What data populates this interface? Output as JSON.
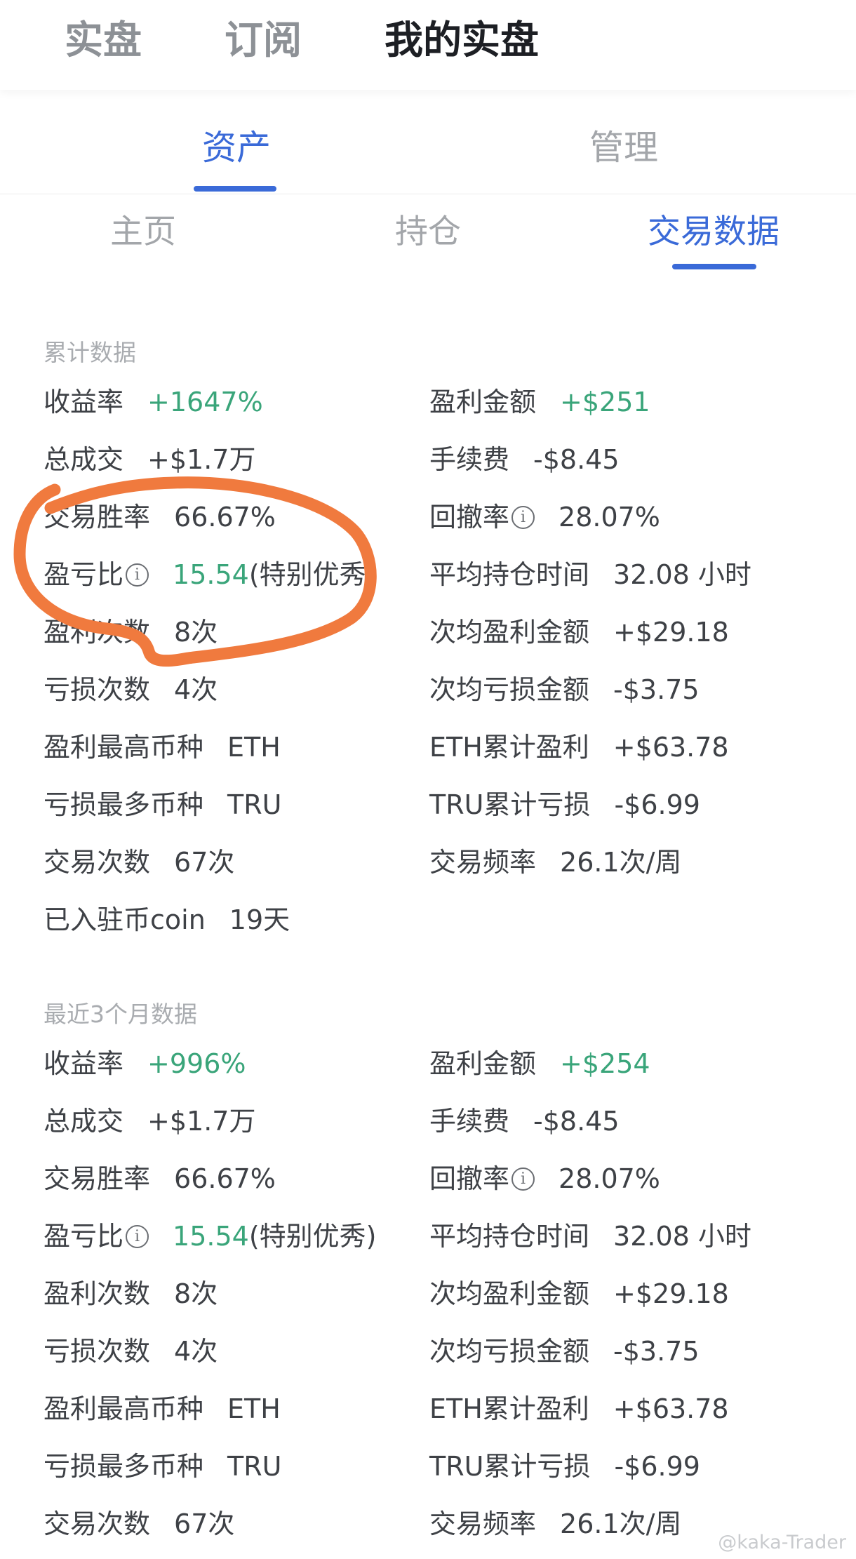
{
  "top_tabs": [
    "实盘",
    "订阅",
    "我的实盘"
  ],
  "top_tab_active": 2,
  "asset_tabs": [
    "资产",
    "管理"
  ],
  "asset_tab_active": 0,
  "sub_tabs": [
    "主页",
    "持仓",
    "交易数据"
  ],
  "sub_tab_active": 2,
  "sections": [
    {
      "title": "累计数据",
      "rows": [
        {
          "left": {
            "label": "收益率",
            "value": "+1647%",
            "green": true
          },
          "right": {
            "label": "盈利金额",
            "value": "+$251",
            "green": true
          }
        },
        {
          "left": {
            "label": "总成交",
            "value": "+$1.7万"
          },
          "right": {
            "label": "手续费",
            "value": "-$8.45"
          }
        },
        {
          "left": {
            "label": "交易胜率",
            "value": "66.67%"
          },
          "right": {
            "label": "回撤率",
            "info": true,
            "value": "28.07%"
          }
        },
        {
          "left": {
            "label": "盈亏比",
            "info": true,
            "value": "15.54",
            "green": true,
            "suffix": "(特别优秀)"
          },
          "right": {
            "label": "平均持仓时间",
            "value": "32.08 小时"
          }
        },
        {
          "left": {
            "label": "盈利次数",
            "value": "8次"
          },
          "right": {
            "label": "次均盈利金额",
            "value": "+$29.18"
          }
        },
        {
          "left": {
            "label": "亏损次数",
            "value": "4次"
          },
          "right": {
            "label": "次均亏损金额",
            "value": "-$3.75"
          }
        },
        {
          "left": {
            "label": "盈利最高币种",
            "value": "ETH"
          },
          "right": {
            "label": "ETH累计盈利",
            "value": "+$63.78"
          }
        },
        {
          "left": {
            "label": "亏损最多币种",
            "value": "TRU"
          },
          "right": {
            "label": "TRU累计亏损",
            "value": "-$6.99"
          }
        },
        {
          "left": {
            "label": "交易次数",
            "value": "67次"
          },
          "right": {
            "label": "交易频率",
            "value": "26.1次/周"
          }
        },
        {
          "left": {
            "label": "已入驻币coin",
            "value": "19天"
          }
        }
      ]
    },
    {
      "title": "最近3个月数据",
      "rows": [
        {
          "left": {
            "label": "收益率",
            "value": "+996%",
            "green": true
          },
          "right": {
            "label": "盈利金额",
            "value": "+$254",
            "green": true
          }
        },
        {
          "left": {
            "label": "总成交",
            "value": "+$1.7万"
          },
          "right": {
            "label": "手续费",
            "value": "-$8.45"
          }
        },
        {
          "left": {
            "label": "交易胜率",
            "value": "66.67%"
          },
          "right": {
            "label": "回撤率",
            "info": true,
            "value": "28.07%"
          }
        },
        {
          "left": {
            "label": "盈亏比",
            "info": true,
            "value": "15.54",
            "green": true,
            "suffix": "(特别优秀)"
          },
          "right": {
            "label": "平均持仓时间",
            "value": "32.08 小时"
          }
        },
        {
          "left": {
            "label": "盈利次数",
            "value": "8次"
          },
          "right": {
            "label": "次均盈利金额",
            "value": "+$29.18"
          }
        },
        {
          "left": {
            "label": "亏损次数",
            "value": "4次"
          },
          "right": {
            "label": "次均亏损金额",
            "value": "-$3.75"
          }
        },
        {
          "left": {
            "label": "盈利最高币种",
            "value": "ETH"
          },
          "right": {
            "label": "ETH累计盈利",
            "value": "+$63.78"
          }
        },
        {
          "left": {
            "label": "亏损最多币种",
            "value": "TRU"
          },
          "right": {
            "label": "TRU累计亏损",
            "value": "-$6.99"
          }
        },
        {
          "left": {
            "label": "交易次数",
            "value": "67次"
          },
          "right": {
            "label": "交易频率",
            "value": "26.1次/周"
          }
        }
      ]
    }
  ],
  "colors": {
    "accent": "#3a6ad8",
    "positive": "#3aa57a",
    "annotation": "#f07a3e"
  },
  "watermark": "@kaka-Trader"
}
